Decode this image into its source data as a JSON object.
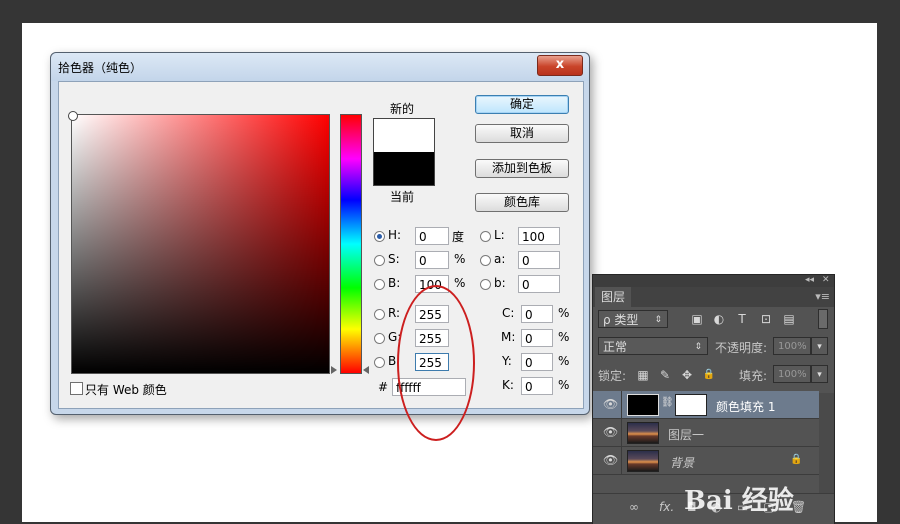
{
  "dialog": {
    "title": "拾色器（纯色）",
    "close_glyph": "x",
    "new_label": "新的",
    "current_label": "当前",
    "buttons": {
      "ok": "确定",
      "cancel": "取消",
      "add_to_swatches": "添加到色板",
      "color_libraries": "颜色库"
    },
    "hsb": {
      "h": {
        "label": "H:",
        "value": "0",
        "unit": "度"
      },
      "s": {
        "label": "S:",
        "value": "0",
        "unit": "%"
      },
      "b": {
        "label": "B:",
        "value": "100",
        "unit": "%"
      }
    },
    "lab": {
      "l": {
        "label": "L:",
        "value": "100"
      },
      "a": {
        "label": "a:",
        "value": "0"
      },
      "b": {
        "label": "b:",
        "value": "0"
      }
    },
    "rgb": {
      "r": {
        "label": "R:",
        "value": "255"
      },
      "g": {
        "label": "G:",
        "value": "255"
      },
      "b": {
        "label": "B:",
        "value": "255"
      }
    },
    "cmyk": {
      "c": {
        "label": "C:",
        "value": "0",
        "unit": "%"
      },
      "m": {
        "label": "M:",
        "value": "0",
        "unit": "%"
      },
      "y": {
        "label": "Y:",
        "value": "0",
        "unit": "%"
      },
      "k": {
        "label": "K:",
        "value": "0",
        "unit": "%"
      }
    },
    "hex": {
      "label": "#",
      "value": "ffffff"
    },
    "web_only_label": "只有 Web 颜色",
    "colors": {
      "new": "#ffffff",
      "current": "#000000",
      "annotation": "#cc1f1f"
    }
  },
  "layers_panel": {
    "top_bar": {
      "collapse": "◂◂",
      "close": "✕"
    },
    "tab": "图层",
    "menu_icon": "▾≡",
    "filter": {
      "label": "ρ 类型",
      "icons": [
        "image-icon",
        "adjustment-icon",
        "text-icon",
        "shape-icon",
        "smart-object-icon"
      ],
      "glyphs": [
        "▣",
        "◐",
        "T",
        "⊡",
        "▤"
      ]
    },
    "blend_mode": "正常",
    "opacity_label": "不透明度:",
    "opacity_value": "100%",
    "lock_label": "锁定:",
    "lock_glyphs": [
      "▦",
      "✎",
      "✥",
      "🔒"
    ],
    "fill_label": "填充:",
    "fill_value": "100%",
    "layers": [
      {
        "name": "颜色填充 1",
        "selected": true
      },
      {
        "name": "图层一",
        "selected": false
      },
      {
        "name": "背景",
        "selected": false,
        "locked": true
      }
    ],
    "bottom_glyphs": [
      "∞",
      "fx.",
      "◘",
      "◐",
      "▭",
      "▢",
      "🗑"
    ]
  },
  "watermark": "Bai 经验"
}
